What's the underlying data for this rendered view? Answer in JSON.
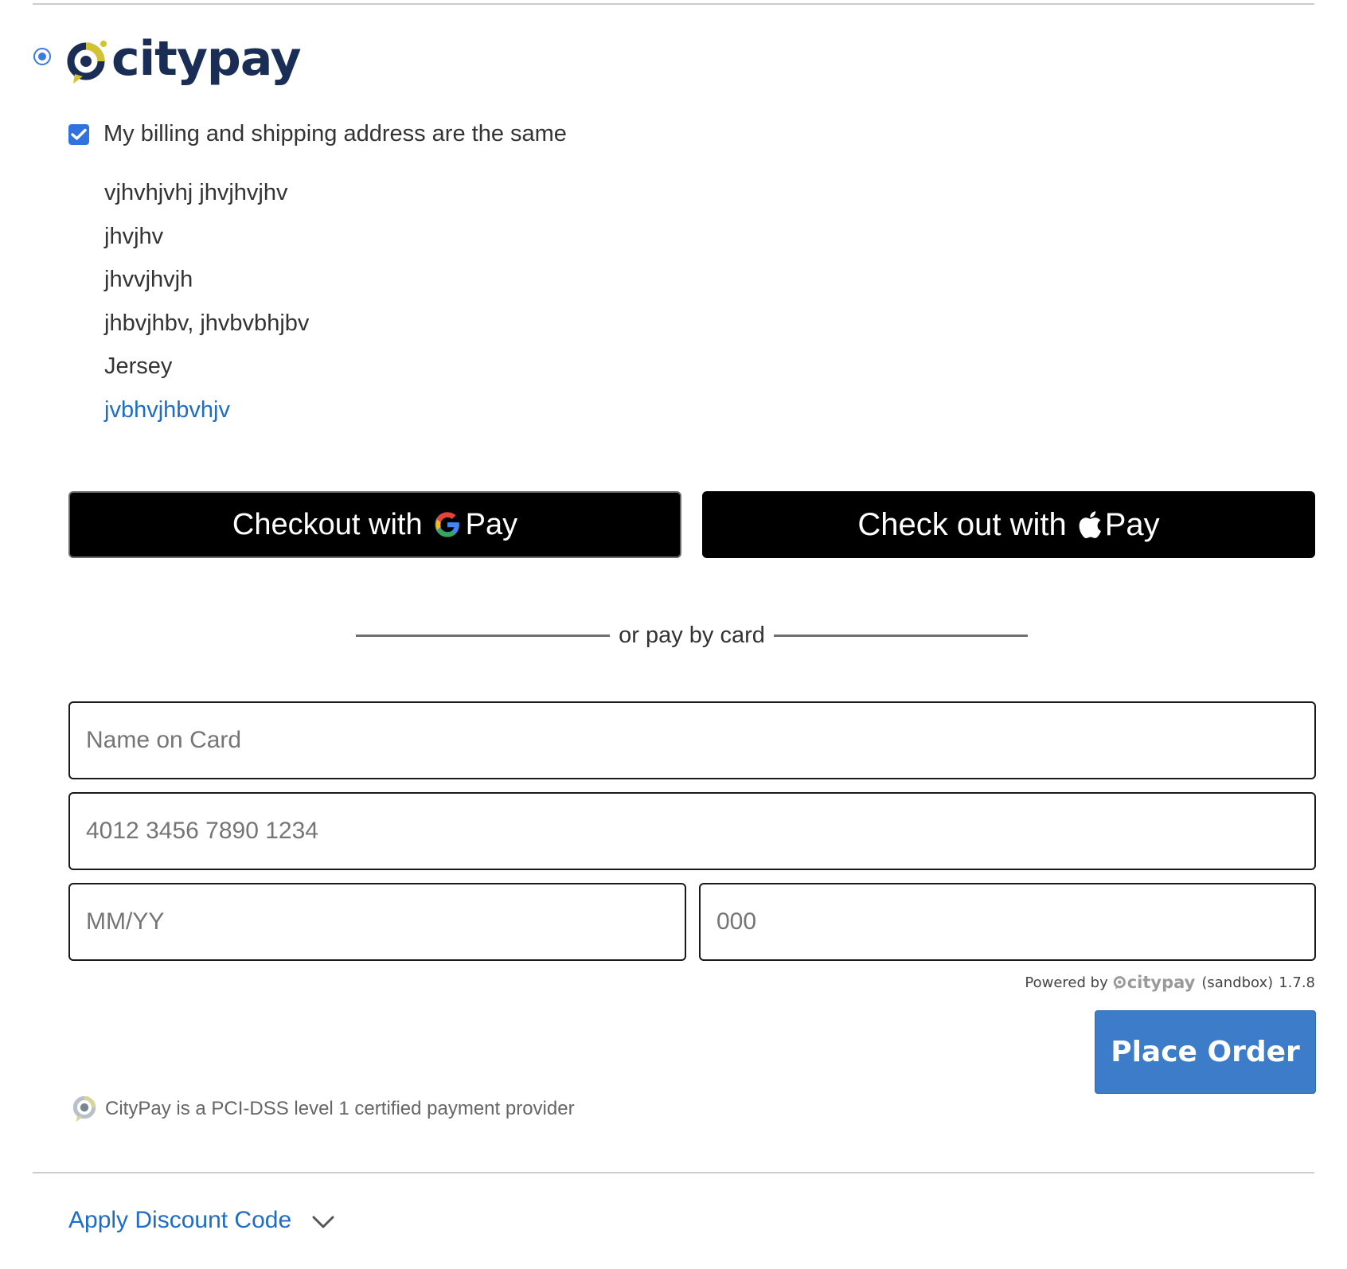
{
  "payment_method": {
    "selected": true,
    "logo_text": "citypay",
    "brand_colors": {
      "navy": "#1a2d55",
      "gold": "#d4c331"
    }
  },
  "billing": {
    "same_as_shipping_checked": true,
    "same_as_shipping_label": "My billing and shipping address are the same",
    "address_lines": [
      "vjhvhjvhj jhvjhvjhv",
      "jhvjhv",
      "jhvvjhvjh",
      "jhbvjhbv, jhvbvbhjbv",
      "Jersey"
    ],
    "phone": "jvbhvjhbvhjv"
  },
  "wallets": {
    "google_pay": {
      "prefix": "Checkout with",
      "suffix": "Pay",
      "icon": "google-g-icon"
    },
    "apple_pay": {
      "prefix": "Check out with",
      "suffix": "Pay",
      "icon": "apple-icon"
    }
  },
  "divider_text": "or pay by card",
  "card_form": {
    "name_placeholder": "Name on Card",
    "number_placeholder": "4012 3456 7890 1234",
    "expiry_placeholder": "MM/YY",
    "cvv_placeholder": "000"
  },
  "powered_by": {
    "prefix": "Powered by",
    "brand": "citypay",
    "mode": "(sandbox)",
    "version": "1.7.8"
  },
  "place_order_label": "Place Order",
  "pci_notice": "CityPay is a PCI-DSS level 1 certified payment provider",
  "discount": {
    "label": "Apply Discount Code",
    "icon": "chevron-down-icon"
  }
}
